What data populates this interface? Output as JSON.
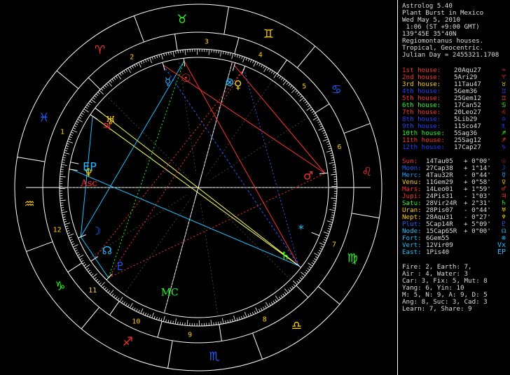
{
  "header": [
    "Astrolog 5.40",
    "Plant Burst in Mexico",
    "Wed May 5, 2010",
    " 1:06 (ST +9:00 GMT)",
    "139°45E 35°40N",
    "Regiomontanus houses.",
    "Tropical, Geocentric.",
    "Julian Day = 2455321.1708"
  ],
  "houses": [
    {
      "label": "1st house:",
      "value": "20Aqu27",
      "color": "#ff3030",
      "glyph": "♒"
    },
    {
      "label": "2nd house:",
      "value": "5Ari29",
      "color": "#ff3030",
      "glyph": "♈"
    },
    {
      "label": "3rd house:",
      "value": "11Tau47",
      "color": "#ffd000",
      "glyph": "♉"
    },
    {
      "label": "4th house:",
      "value": "5Gem36",
      "color": "#2040ff",
      "glyph": "♊"
    },
    {
      "label": "5th house:",
      "value": "25Gem12",
      "color": "#ff3030",
      "glyph": "♊"
    },
    {
      "label": "6th house:",
      "value": "17Can52",
      "color": "#20ff20",
      "glyph": "♋"
    },
    {
      "label": "7th house:",
      "value": "20Leo27",
      "color": "#ff3030",
      "glyph": "♌"
    },
    {
      "label": "8th house:",
      "value": "5Lib29",
      "color": "#2040ff",
      "glyph": "♎"
    },
    {
      "label": "9th house:",
      "value": "11Sco47",
      "color": "#2040ff",
      "glyph": "♏"
    },
    {
      "label": "10th house:",
      "value": "5Sag36",
      "color": "#20ff20",
      "glyph": "♐"
    },
    {
      "label": "11th house:",
      "value": "25Sag12",
      "color": "#ff3030",
      "glyph": "♐"
    },
    {
      "label": "12th house:",
      "value": "17Cap27",
      "color": "#2040ff",
      "glyph": "♑"
    }
  ],
  "planets": [
    {
      "label": "Sun:",
      "value": "14Tau05",
      "motion": "+ 0°00'",
      "color": "#ff3030",
      "glyph": "☉"
    },
    {
      "label": "Moon:",
      "value": "27Cap38",
      "motion": "+ 1°14'",
      "color": "#2060ff",
      "glyph": "☽"
    },
    {
      "label": "Merc:",
      "value": "4Tau32R",
      "motion": "- 0°44'",
      "color": "#20a0ff",
      "glyph": "☿"
    },
    {
      "label": "Venu:",
      "value": "11Gem29",
      "motion": "+ 0°58'",
      "color": "#ffd000",
      "glyph": "♀"
    },
    {
      "label": "Mars:",
      "value": "14Leo01",
      "motion": "+ 1°59'",
      "color": "#ff3030",
      "glyph": "♂"
    },
    {
      "label": "Jupi:",
      "value": "24Pis31",
      "motion": "- 1°03'",
      "color": "#ff3030",
      "glyph": "♃"
    },
    {
      "label": "Satu:",
      "value": "28Vir24R",
      "motion": "+ 2°31'",
      "color": "#20ff20",
      "glyph": "♄"
    },
    {
      "label": "Uran:",
      "value": "28Pis07",
      "motion": "- 0°44'",
      "color": "#ffd000",
      "glyph": "♅"
    },
    {
      "label": "Nept:",
      "value": "28Aqu31",
      "motion": "- 0°27'",
      "color": "#ffd000",
      "glyph": "♆"
    },
    {
      "label": "Plut:",
      "value": "5Cap14R",
      "motion": "+ 5°09'",
      "color": "#2060ff",
      "glyph": "♇"
    },
    {
      "label": "Node:",
      "value": "15Cap65R",
      "motion": "+ 0°00'",
      "color": "#20c0ff",
      "glyph": "☊"
    },
    {
      "label": "Fort:",
      "value": "6Gem55",
      "motion": "",
      "color": "#20c0ff",
      "glyph": "⊗"
    },
    {
      "label": "Vert:",
      "value": "12Vir09",
      "motion": "",
      "color": "#20c0ff",
      "glyph": "Vx"
    },
    {
      "label": "East:",
      "value": "1Pis40",
      "motion": "",
      "color": "#20c0ff",
      "glyph": "EP"
    }
  ],
  "summary": [
    "Fire: 2, Earth: 7,",
    "Air : 4, Water: 3",
    "Car: 3, Fix: 5, Mut: 8",
    "Yang: 6, Yin: 10",
    "M: 5, N: 9, A: 9, D: 5",
    "Ang: 8, Suc: 3, Cad: 3",
    "Learn: 7, Share: 9"
  ],
  "signs": [
    {
      "glyph": "♈",
      "color": "#ff3030",
      "name": "aries-icon"
    },
    {
      "glyph": "♉",
      "color": "#20ff20",
      "name": "taurus-icon"
    },
    {
      "glyph": "♊",
      "color": "#ffd000",
      "name": "gemini-icon"
    },
    {
      "glyph": "♋",
      "color": "#2060ff",
      "name": "cancer-icon"
    },
    {
      "glyph": "♌",
      "color": "#ff3030",
      "name": "leo-icon"
    },
    {
      "glyph": "♍",
      "color": "#20ff20",
      "name": "virgo-icon"
    },
    {
      "glyph": "♎",
      "color": "#ffd000",
      "name": "libra-icon"
    },
    {
      "glyph": "♏",
      "color": "#2060ff",
      "name": "scorpio-icon"
    },
    {
      "glyph": "♐",
      "color": "#ff3030",
      "name": "sagittarius-icon"
    },
    {
      "glyph": "♑",
      "color": "#20ff20",
      "name": "capricorn-icon"
    },
    {
      "glyph": "♒",
      "color": "#ffd000",
      "name": "aquarius-icon"
    },
    {
      "glyph": "♓",
      "color": "#2060ff",
      "name": "pisces-icon"
    }
  ],
  "house_numbers": [
    "1",
    "2",
    "3",
    "4",
    "5",
    "6",
    "7",
    "8",
    "9",
    "10",
    "11",
    "12"
  ],
  "wheel_planets": [
    {
      "name": "sun-icon",
      "glyph": "☉",
      "color": "#ff3030",
      "lon": 44.08
    },
    {
      "name": "moon-icon",
      "glyph": "☽",
      "color": "#2060ff",
      "lon": 297.63
    },
    {
      "name": "mercury-icon",
      "glyph": "☿",
      "color": "#20a0ff",
      "lon": 34.53
    },
    {
      "name": "venus-icon",
      "glyph": "♀",
      "color": "#ffd000",
      "lon": 71.48
    },
    {
      "name": "mars-icon",
      "glyph": "♂",
      "color": "#ff3030",
      "lon": 134.02
    },
    {
      "name": "jupiter-icon",
      "glyph": "♃",
      "color": "#ff3030",
      "lon": 354.52
    },
    {
      "name": "saturn-icon",
      "glyph": "♄",
      "color": "#20ff20",
      "lon": 178.4
    },
    {
      "name": "uranus-icon",
      "glyph": "♅",
      "color": "#ffd000",
      "lon": 358.12
    },
    {
      "name": "neptune-icon",
      "glyph": "♆",
      "color": "#ffd000",
      "lon": 328.52
    },
    {
      "name": "pluto-icon",
      "glyph": "♇",
      "color": "#2060ff",
      "lon": 275.23
    },
    {
      "name": "node-icon",
      "glyph": "☊",
      "color": "#20c0ff",
      "lon": 285.9
    },
    {
      "name": "fortune-icon",
      "glyph": "⊗",
      "color": "#20c0ff",
      "lon": 66.92
    },
    {
      "name": "vertex-icon",
      "glyph": "*",
      "color": "#20c0ff",
      "lon": 162.15
    },
    {
      "name": "eastpoint-icon",
      "glyph": "EP",
      "color": "#20c0ff",
      "lon": 331.67
    }
  ],
  "angles": {
    "asc": "Asc",
    "mc": "MC",
    "asc_color": "#ff3030",
    "mc_color": "#20ff20"
  }
}
